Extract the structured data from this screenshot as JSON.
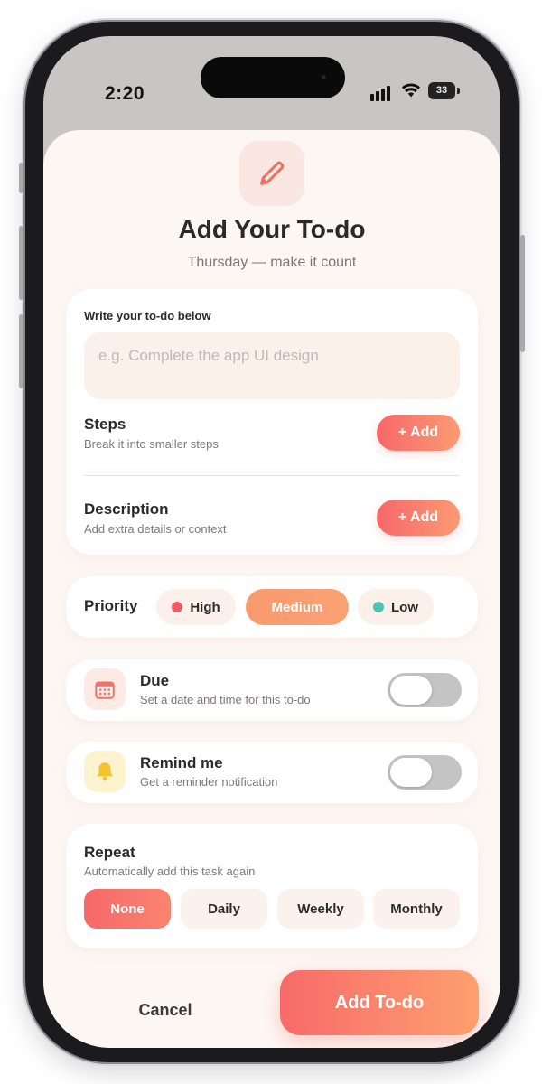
{
  "status": {
    "time": "2:20",
    "battery": "33"
  },
  "header": {
    "title": "Add Your To-do",
    "subtitle": "Thursday — make it count",
    "icon": "pencil-icon"
  },
  "todo": {
    "label": "Write your to-do below",
    "placeholder": "e.g. Complete the app UI design",
    "steps": {
      "title": "Steps",
      "subtitle": "Break it into smaller steps",
      "button": "+ Add"
    },
    "description": {
      "title": "Description",
      "subtitle": "Add extra details or context",
      "button": "+ Add"
    }
  },
  "priority": {
    "label": "Priority",
    "options": [
      {
        "label": "High",
        "dot_color": "#f05a63"
      },
      {
        "label": "Medium",
        "selected": true
      },
      {
        "label": "Low",
        "dot_color": "#4fc3b2"
      }
    ]
  },
  "due": {
    "title": "Due",
    "subtitle": "Set a date and time for this to-do",
    "icon": "calendar-icon",
    "enabled": false
  },
  "remind": {
    "title": "Remind me",
    "subtitle": "Get a reminder notification",
    "icon": "bell-icon",
    "enabled": false
  },
  "repeat": {
    "title": "Repeat",
    "subtitle": "Automatically add this task again",
    "options": [
      "None",
      "Daily",
      "Weekly",
      "Monthly"
    ],
    "selected": "None"
  },
  "actions": {
    "cancel": "Cancel",
    "submit": "Add To-do"
  },
  "colors": {
    "accent_start": "#f6686a",
    "accent_end": "#fc9a72",
    "background": "#fdf7f4"
  }
}
